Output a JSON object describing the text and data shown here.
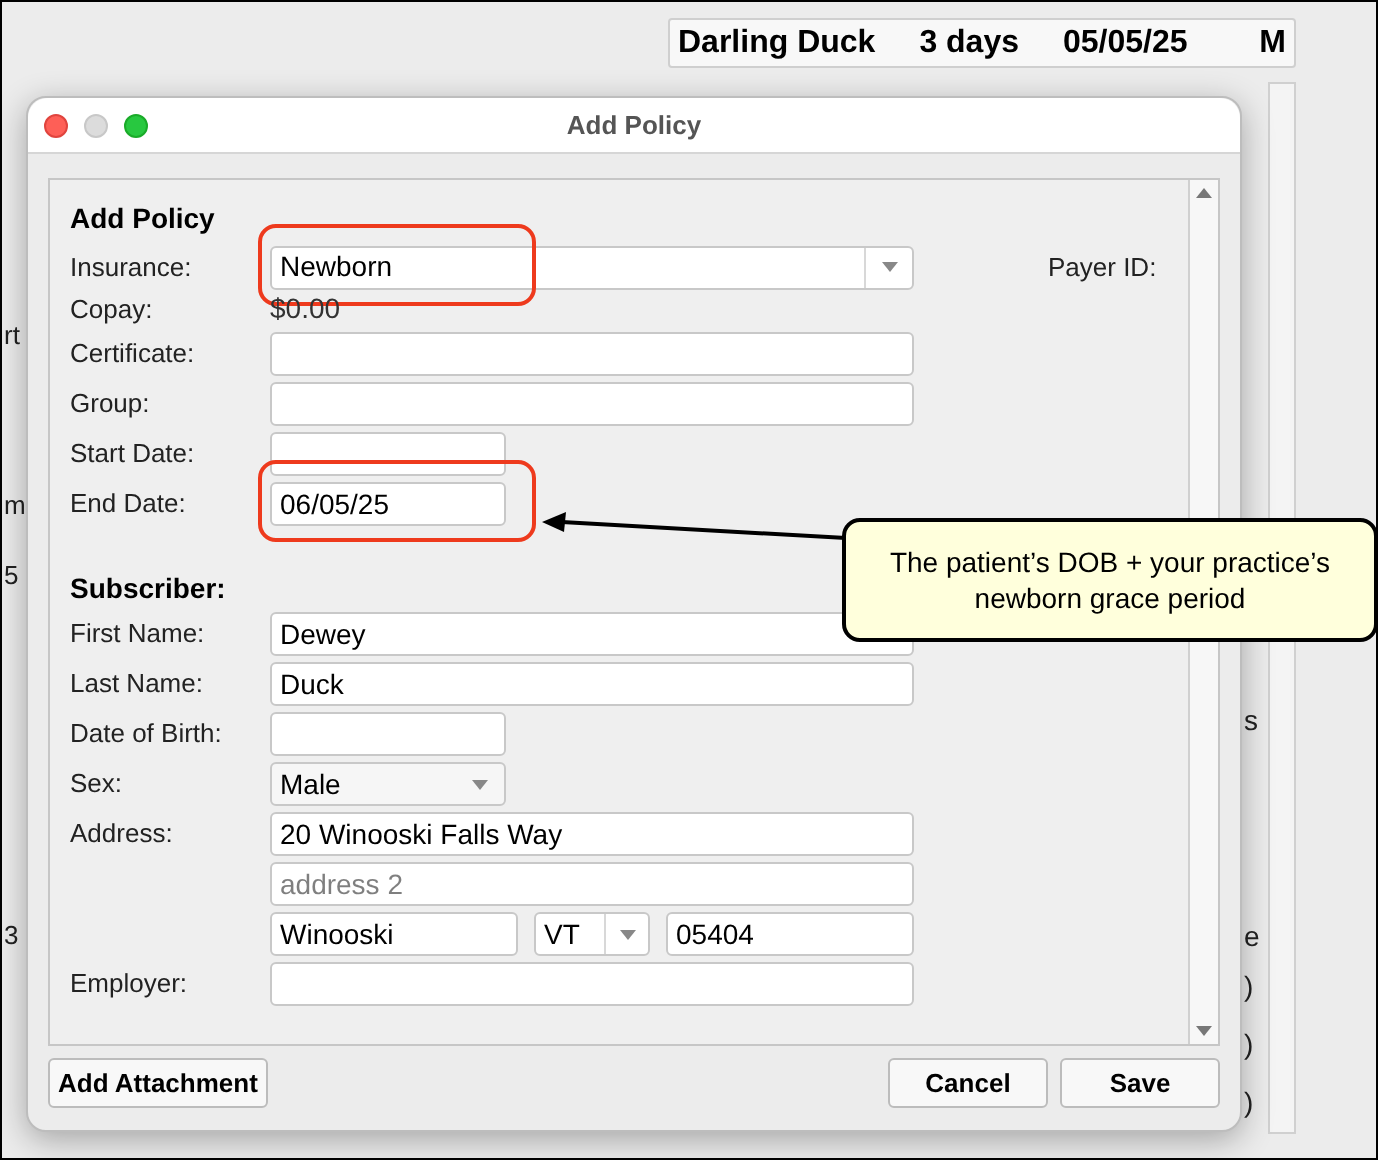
{
  "header": {
    "name": "Darling Duck",
    "age": "3 days",
    "date": "05/05/25",
    "sex": "M"
  },
  "background_left_fragments": [
    "rt",
    "m",
    "5",
    "3"
  ],
  "background_right_fragments": [
    "s",
    "e",
    ")",
    ")",
    ")"
  ],
  "dialog": {
    "title": "Add Policy"
  },
  "form": {
    "heading": "Add Policy",
    "payer_id_label": "Payer ID:",
    "subscriber_heading": "Subscriber:",
    "policy_fields": [
      {
        "kind": "select_wide",
        "label": "Insurance:",
        "value": "Newborn",
        "highlighted": true
      },
      {
        "kind": "static",
        "label": "Copay:",
        "value": "$0.00"
      },
      {
        "kind": "text_wide",
        "label": "Certificate:"
      },
      {
        "kind": "text_wide",
        "label": "Group:"
      },
      {
        "kind": "text_short",
        "label": "Start Date:"
      },
      {
        "kind": "text_short",
        "label": "End Date:",
        "value": "06/05/25",
        "highlighted": true
      }
    ],
    "subscriber_fields": [
      {
        "kind": "text_wide",
        "label": "First Name:",
        "value": "Dewey"
      },
      {
        "kind": "text_wide",
        "label": "Last Name:",
        "value": "Duck"
      },
      {
        "kind": "text_short",
        "label": "Date of Birth:"
      },
      {
        "kind": "select_short",
        "label": "Sex:",
        "value": "Male"
      },
      {
        "kind": "text_wide",
        "label": "Address:",
        "value": "20 Winooski Falls Way"
      },
      {
        "kind": "text_wide",
        "placeholder": "address 2"
      },
      {
        "kind": "city_state_zip",
        "city": "Winooski",
        "state": "VT",
        "zip": "05404"
      },
      {
        "kind": "text_wide",
        "label": "Employer:"
      }
    ]
  },
  "buttons": {
    "attachment": "Add Attachment",
    "cancel": "Cancel",
    "save": "Save"
  },
  "callout": {
    "text": "The patient’s DOB + your practice’s newborn grace period"
  }
}
